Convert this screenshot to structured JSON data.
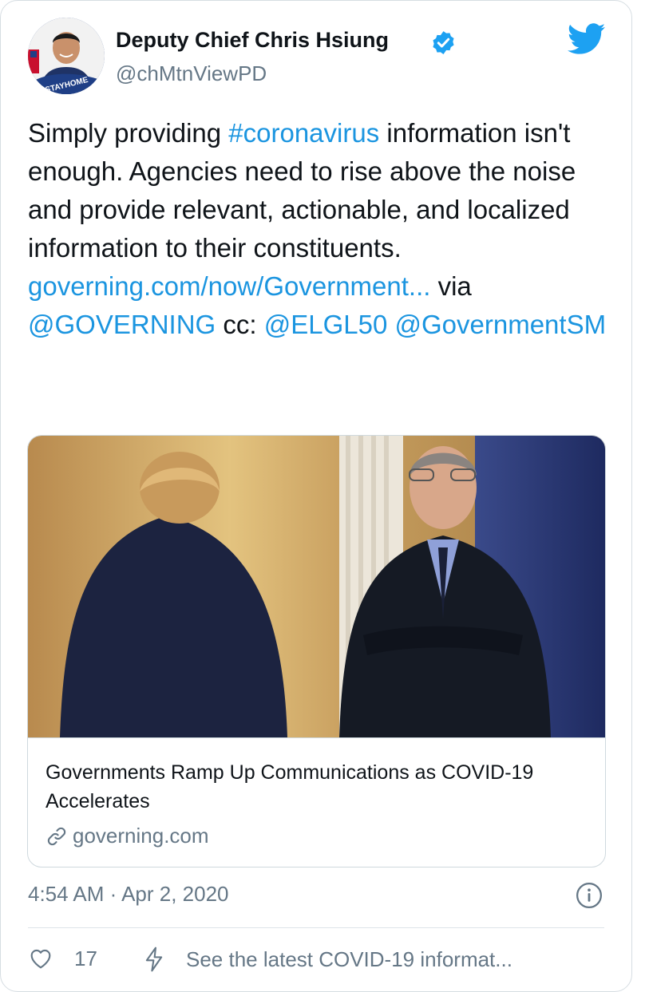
{
  "author": {
    "name": "Deputy Chief Chris Hsiung",
    "handle": "@chMtnViewPD",
    "avatar_badge": "#STAYHOME"
  },
  "tweet": {
    "text_1": "Simply providing ",
    "hashtag": "#coronavirus",
    "text_2": " information isn't enough. Agencies need to rise above the noise and provide relevant, actionable, and localized information to their constituents. ",
    "url": "governing.com/now/Government...",
    "text_3": " via ",
    "mention_1": "@GOVERNING",
    "text_4": " cc: ",
    "mention_2": "@ELGL50",
    "text_5": " ",
    "mention_3": "@GovernmentSM"
  },
  "card": {
    "title": "Governments Ramp Up Communications as COVID-19 Accelerates",
    "domain": "governing.com"
  },
  "meta": {
    "timestamp": "4:54 AM · Apr 2, 2020"
  },
  "actions": {
    "like_count": "17",
    "covid_banner": "See the latest COVID-19 informat..."
  },
  "colors": {
    "link": "#1b95e0",
    "secondary": "#657786",
    "border": "#cfd9de"
  },
  "icons": [
    "twitter-bird-icon",
    "verified-badge-icon",
    "link-icon",
    "info-icon",
    "heart-icon",
    "lightning-icon"
  ]
}
